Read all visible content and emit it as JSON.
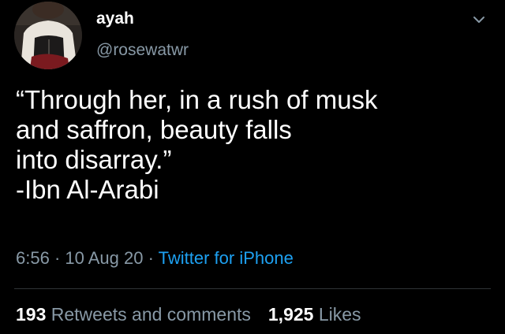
{
  "user": {
    "display_name": "ayah",
    "handle": "@rosewatwr"
  },
  "icons": {
    "avatar": "profile-photo",
    "menu": "chevron-down-icon"
  },
  "tweet": {
    "lines": [
      "“Through her, in a rush of musk",
      "and saffron, beauty falls",
      "into disarray.”",
      "-Ibn Al-Arabi"
    ]
  },
  "meta": {
    "time": "6:56",
    "separator1": " · ",
    "date": "10 Aug 20",
    "separator2": " · ",
    "source": "Twitter for iPhone"
  },
  "stats": {
    "retweets_count": "193",
    "retweets_label": "Retweets and comments",
    "likes_count": "1,925",
    "likes_label": "Likes"
  },
  "colors": {
    "background": "#000000",
    "text": "#ffffff",
    "secondary": "#8899a6",
    "link": "#1da1f2",
    "divider": "#2f3336"
  }
}
